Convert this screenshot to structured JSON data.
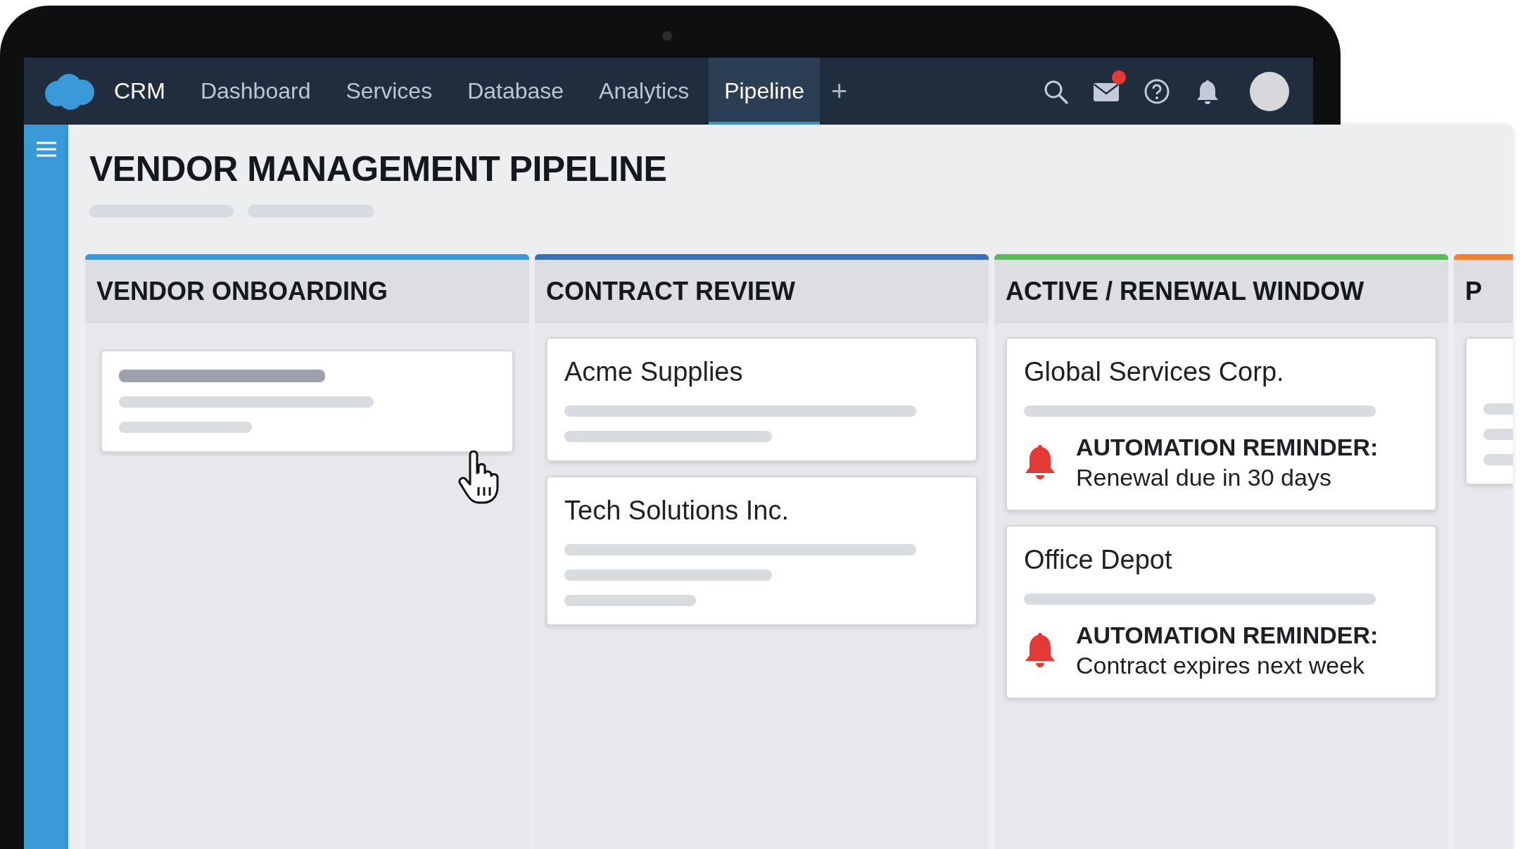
{
  "nav": {
    "brand": "CRM",
    "tabs": [
      {
        "label": "Dashboard",
        "selected": false
      },
      {
        "label": "Services",
        "selected": false
      },
      {
        "label": "Database",
        "selected": false
      },
      {
        "label": "Analytics",
        "selected": false
      },
      {
        "label": "Pipeline",
        "selected": true
      }
    ],
    "add": "+",
    "mail_unread": true
  },
  "page": {
    "title": "VENDOR MANAGEMENT PIPELINE"
  },
  "columns": [
    {
      "title": "VENDOR ONBOARDING",
      "color": "#3a9ad9",
      "cards": [
        {
          "kind": "blank"
        }
      ]
    },
    {
      "title": "CONTRACT REVIEW",
      "color": "#3a6fb8",
      "cards": [
        {
          "kind": "short",
          "title": "Acme Supplies"
        },
        {
          "kind": "long",
          "title": "Tech Solutions Inc."
        }
      ]
    },
    {
      "title": "ACTIVE / RENEWAL WINDOW",
      "color": "#5cb85c",
      "cards": [
        {
          "kind": "reminder",
          "title": "Global Services Corp.",
          "reminder": {
            "label": "AUTOMATION REMINDER:",
            "text": "Renewal due in 30 days"
          }
        },
        {
          "kind": "reminder",
          "title": "Office Depot",
          "reminder": {
            "label": "AUTOMATION REMINDER:",
            "text": "Contract expires next week"
          }
        }
      ]
    },
    {
      "title": "P",
      "color": "#f08030",
      "cards": [
        {
          "kind": "long"
        }
      ]
    }
  ]
}
